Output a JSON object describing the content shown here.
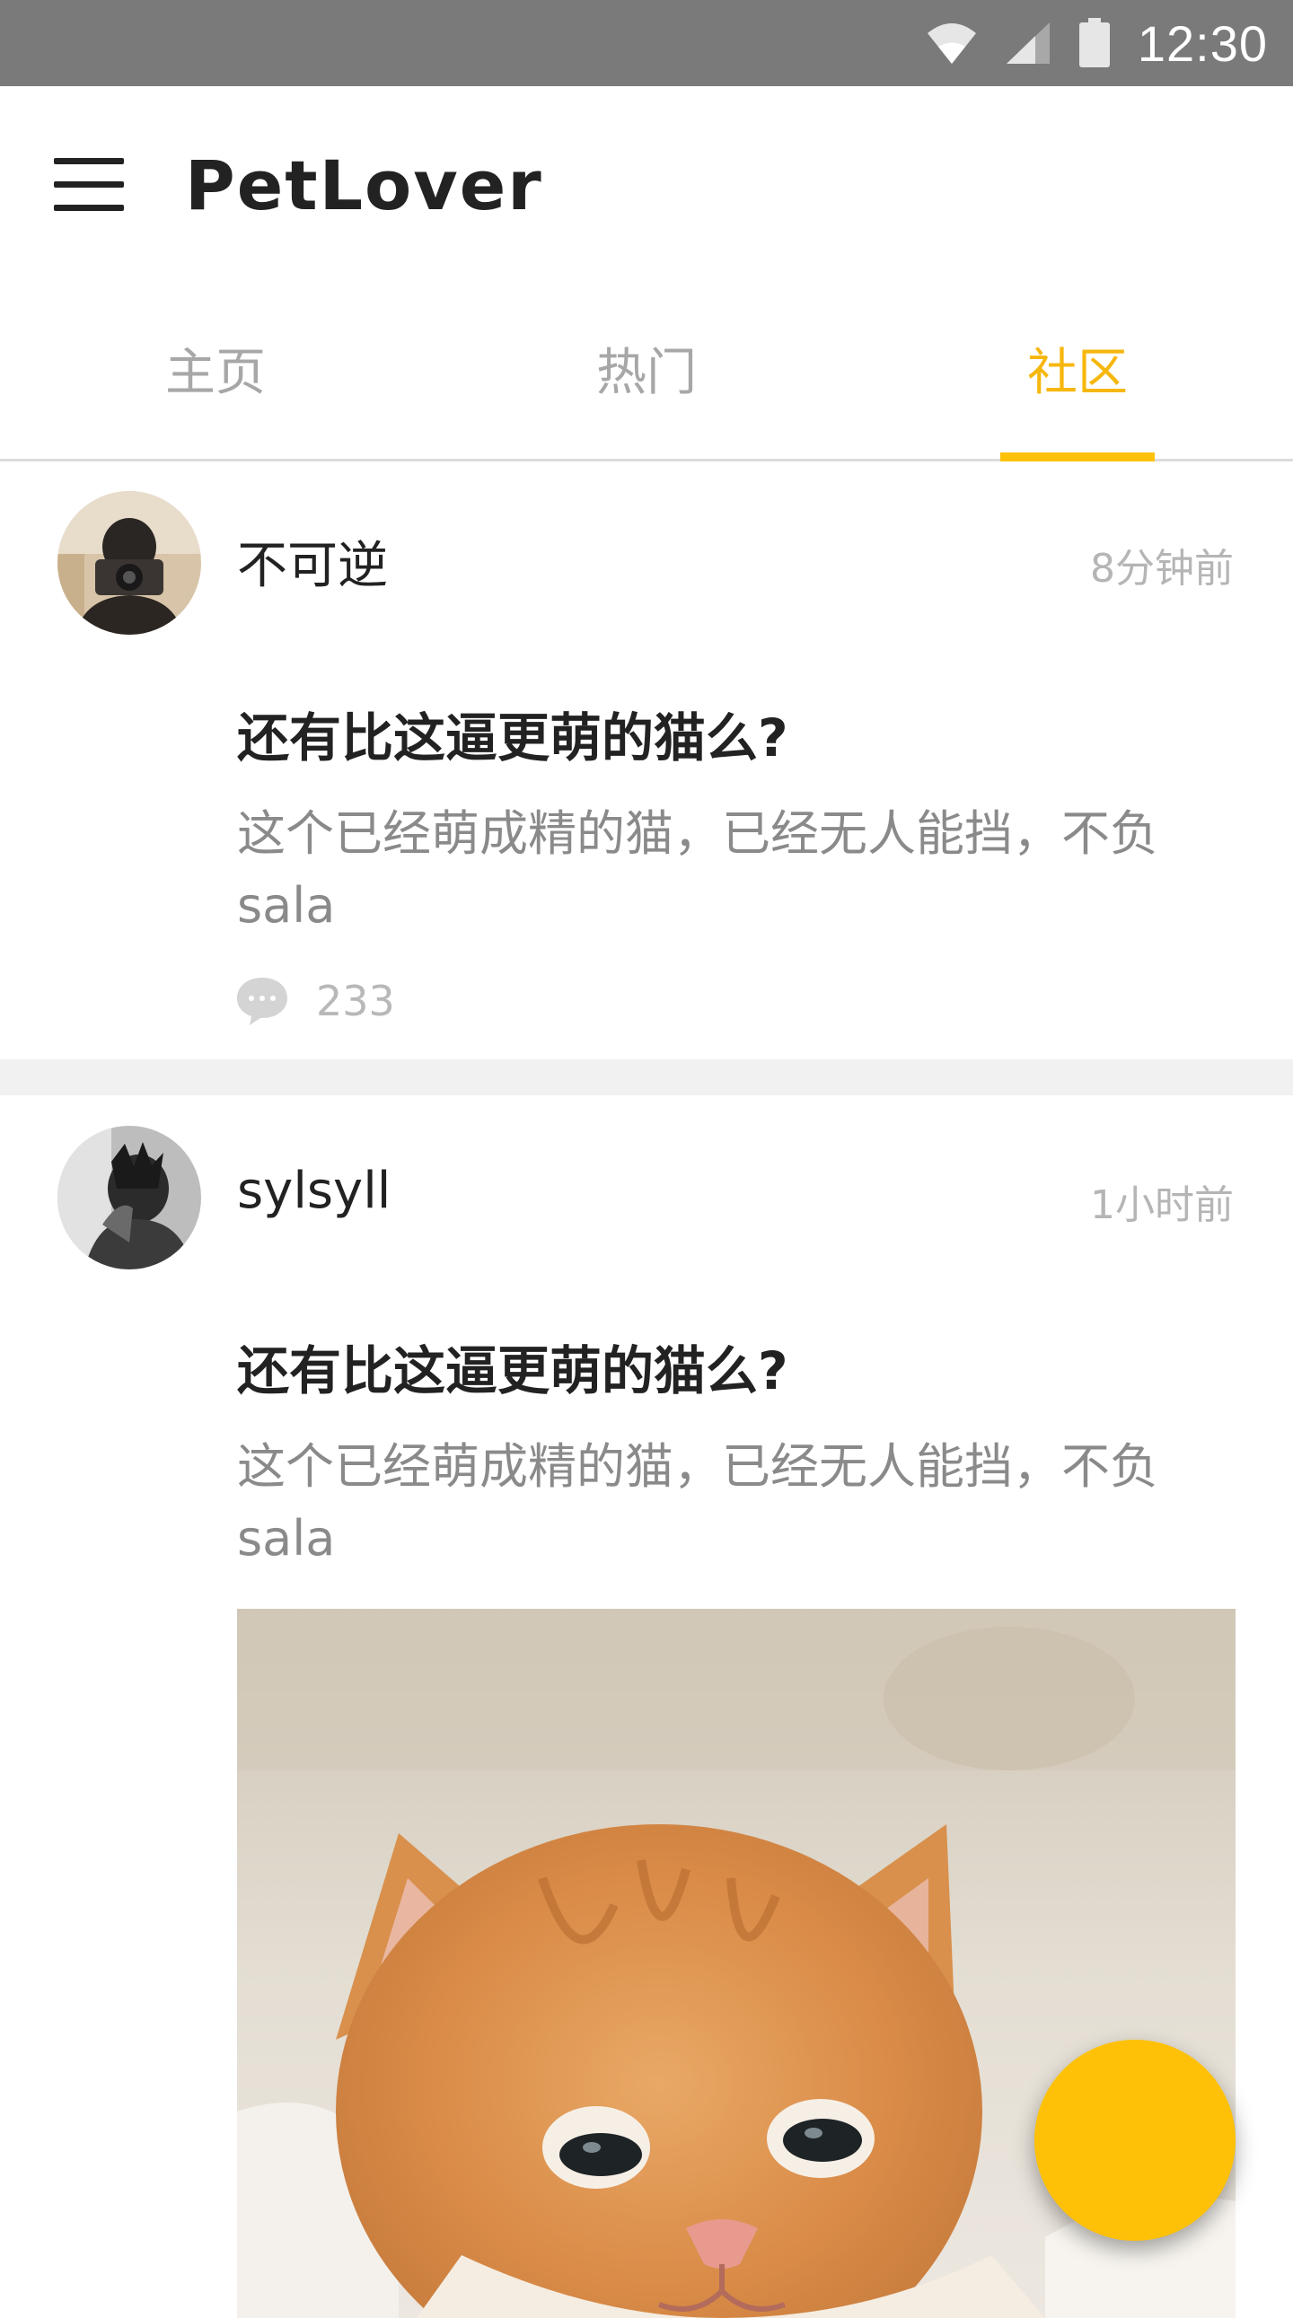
{
  "status_bar": {
    "time": "12:30",
    "icons": [
      "wifi-icon",
      "signal-icon",
      "battery-icon"
    ]
  },
  "app_bar": {
    "title": "PetLover",
    "menu_icon": "menu-icon"
  },
  "tabs": [
    {
      "label": "主页",
      "active": false
    },
    {
      "label": "热门",
      "active": false
    },
    {
      "label": "社区",
      "active": true
    }
  ],
  "posts": [
    {
      "author": "不可逆",
      "time": "8分钟前",
      "title": "还有比这逼更萌的猫么?",
      "body": "这个已经萌成精的猫，已经无人能挡，不负sala",
      "comment_count": "233"
    },
    {
      "author": "sylsyll",
      "time": "1小时前",
      "title": "还有比这逼更萌的猫么?",
      "body": "这个已经萌成精的猫，已经无人能挡，不负sala"
    }
  ],
  "colors": {
    "accent": "#ffc107",
    "status_bar": "#7a7a7a",
    "text_primary": "#222222",
    "text_secondary": "#8a8a8a",
    "text_muted": "#b5b5b5"
  }
}
